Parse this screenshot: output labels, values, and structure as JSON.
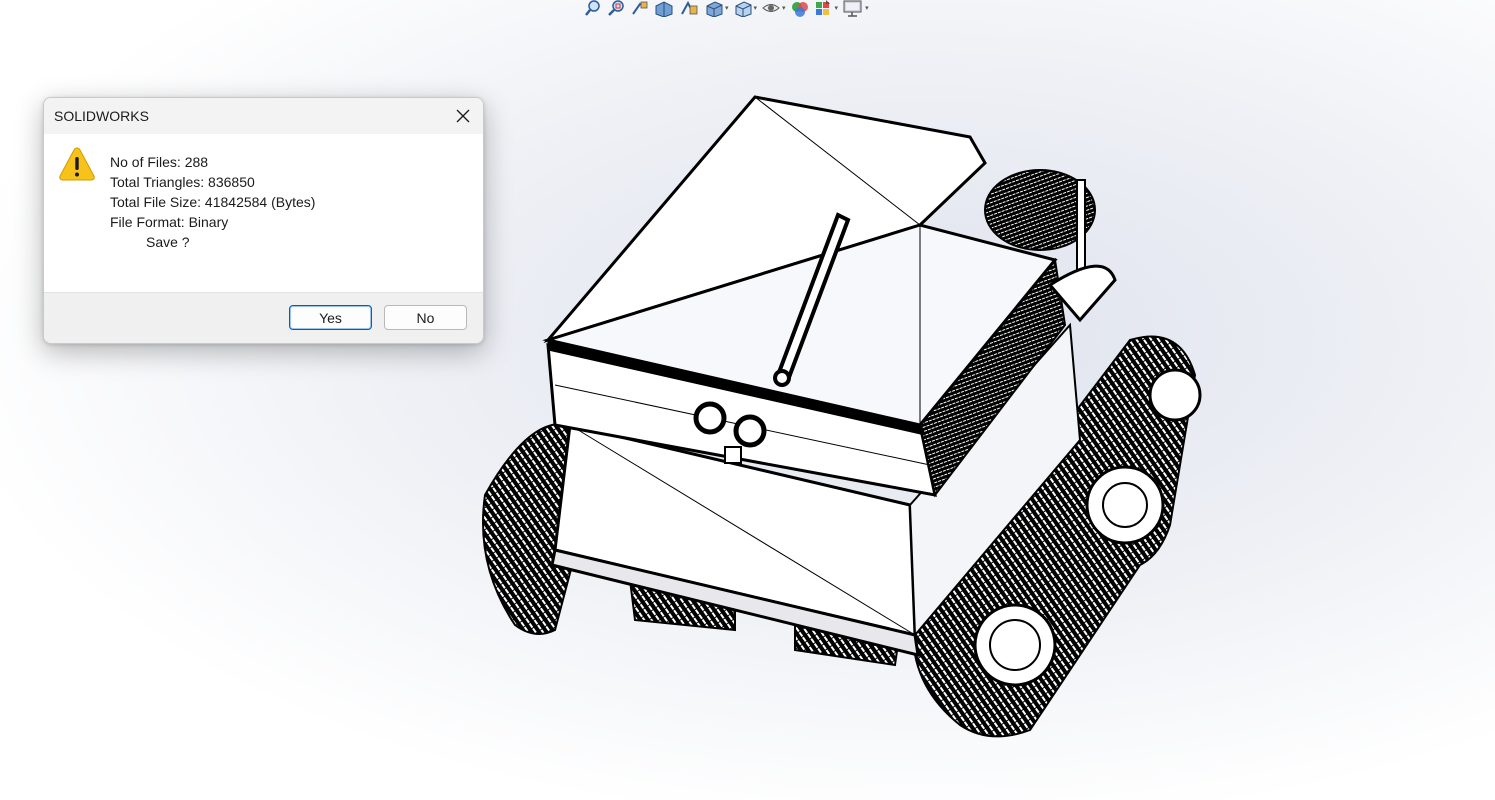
{
  "toolbar": {
    "buttons": [
      {
        "icon": "zoom-to-fit-icon",
        "caret": false
      },
      {
        "icon": "zoom-to-area-icon",
        "caret": false
      },
      {
        "icon": "previous-view-icon",
        "caret": false
      },
      {
        "icon": "section-view-icon",
        "caret": false
      },
      {
        "icon": "dynamic-annotation-icon",
        "caret": false
      },
      {
        "icon": "view-orientation-icon",
        "caret": true
      },
      {
        "icon": "display-style-icon",
        "caret": true
      },
      {
        "icon": "hide-show-items-icon",
        "caret": true
      },
      {
        "icon": "edit-appearance-icon",
        "caret": false
      },
      {
        "icon": "apply-scene-icon",
        "caret": true
      },
      {
        "icon": "view-settings-icon",
        "caret": true
      }
    ],
    "caret_glyph": "▾"
  },
  "dialog": {
    "title": "SOLIDWORKS",
    "icon": "warning-icon",
    "lines": {
      "files": "No of Files: 288",
      "triangles": "Total Triangles: 836850",
      "size": "Total File Size: 41842584 (Bytes)",
      "format": "File Format: Binary",
      "prompt": "Save ?"
    },
    "yes_label": "Yes",
    "no_label": "No"
  },
  "colors": {
    "accent": "#005fb8",
    "warning": "#f7c31a"
  }
}
